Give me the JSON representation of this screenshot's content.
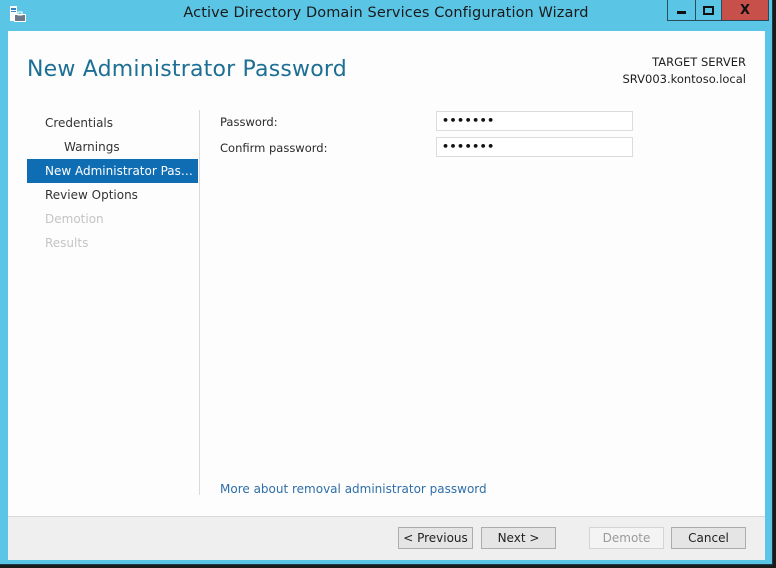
{
  "window": {
    "title": "Active Directory Domain Services Configuration Wizard",
    "icon": "server-briefcase-icon",
    "controls": {
      "minimize": "minimize",
      "maximize": "maximize",
      "close": "X"
    }
  },
  "header": {
    "page_title": "New Administrator Password",
    "target_server_label": "TARGET SERVER",
    "target_server_name": "SRV003.kontoso.local"
  },
  "sidebar": {
    "items": [
      {
        "label": "Credentials",
        "state": "normal",
        "level": 0
      },
      {
        "label": "Warnings",
        "state": "normal",
        "level": 1
      },
      {
        "label": "New Administrator Passw...",
        "state": "active",
        "level": 0
      },
      {
        "label": "Review Options",
        "state": "normal",
        "level": 0
      },
      {
        "label": "Demotion",
        "state": "disabled",
        "level": 0
      },
      {
        "label": "Results",
        "state": "disabled",
        "level": 0
      }
    ]
  },
  "form": {
    "password_label": "Password:",
    "password_value": "•••••••",
    "confirm_label": "Confirm password:",
    "confirm_value": "•••••••"
  },
  "help_link": "More about removal administrator password",
  "footer": {
    "previous": "< Previous",
    "next": "Next >",
    "demote": "Demote",
    "cancel": "Cancel"
  },
  "colors": {
    "window_frame": "#5bc5e6",
    "close_button": "#c7504a",
    "title_accent": "#1d6f94",
    "nav_active": "#0f6db4",
    "link": "#2f6fa8"
  }
}
